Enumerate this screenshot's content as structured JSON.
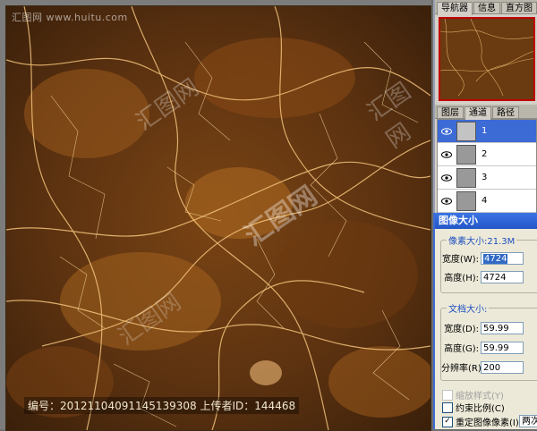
{
  "watermark": {
    "corner_text": "汇图网 www.huitu.com",
    "center_text": "汇图网"
  },
  "infobar": {
    "text": "编号：20121104091145139308 上传者ID：144468"
  },
  "navigator_tabs": [
    "导航器",
    "信息",
    "直方图"
  ],
  "channel_tabs": [
    "图层",
    "通道",
    "路径"
  ],
  "channels": [
    {
      "label": "1",
      "selected": true
    },
    {
      "label": "2",
      "selected": false
    },
    {
      "label": "3",
      "selected": false
    },
    {
      "label": "4",
      "selected": false
    }
  ],
  "dialog": {
    "title": "图像大小",
    "pixel_group_title": "像素大小:21.3M",
    "width_label": "宽度(W):",
    "width_value": "4724",
    "height_label": "高度(H):",
    "height_value": "4724",
    "doc_group_title": "文档大小:",
    "doc_width_label": "宽度(D):",
    "doc_width_value": "59.99",
    "doc_height_label": "高度(G):",
    "doc_height_value": "59.99",
    "resolution_label": "分辨率(R):",
    "resolution_value": "200",
    "scale_styles_label": "缩放样式(Y)",
    "constrain_label": "约束比例(C)",
    "resample_label": "重定图像像素(I):",
    "resample_method": "两次"
  },
  "colors": {
    "marble_dark": "#4a2a0c",
    "marble_mid": "#8a4f17",
    "vein": "#f0b860",
    "selection": "#3d6bd6",
    "dialog_bg": "#ece9d8"
  }
}
